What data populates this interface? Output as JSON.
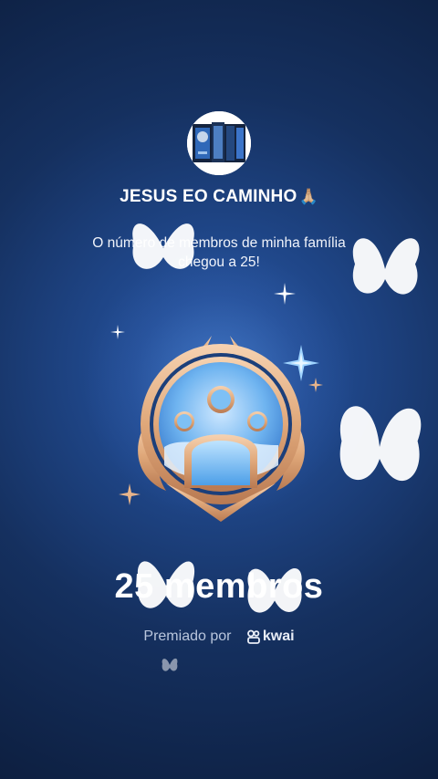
{
  "profile": {
    "name": "JESUS EO CAMINHO",
    "name_emoji": "🙏🏼",
    "message_line1": "O número de membros de minha família",
    "message_line2": "chegou a 25!"
  },
  "achievement": {
    "members_count_text": "25 membros",
    "awarded_by_label": "Premiado por",
    "brand": "kwai"
  },
  "colors": {
    "background": "#1f4688",
    "badge_gold": "#e0a87a",
    "badge_blue": "#5aaef0"
  },
  "icons": [
    "avatar-image",
    "sparkle-icon",
    "butterfly-icon",
    "family-badge-icon",
    "kwai-logo-icon"
  ]
}
